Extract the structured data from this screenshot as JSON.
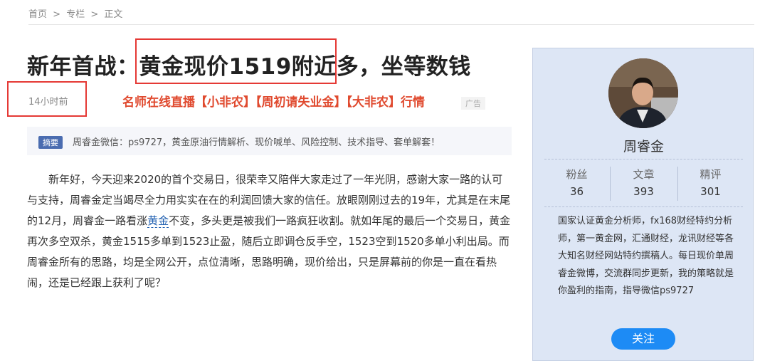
{
  "breadcrumb": {
    "home": "首页",
    "column": "专栏",
    "current": "正文",
    "sep": ">"
  },
  "article": {
    "title": "新年首战：黄金现价1519附近多，坐等数钱",
    "title_parts": [
      "新年首战：",
      "黄金现价1519附近多",
      "，坐等数钱"
    ],
    "time": "14小时前",
    "ad_link": "名师在线直播【小非农】【周初请失业金】【大非农】行情",
    "ad_tag": "广告",
    "summary_tag": "摘要",
    "summary_text": "周睿金微信：ps9727，黄金原油行情解析、现价喊单、风险控制、技术指导、套单解套！",
    "body_before_kw": "新年好，今天迎来2020的首个交易日，很荣幸又陪伴大家走过了一年光阴，感谢大家一路的认可与支持，周睿金定当竭尽全力用实实在在的利润回馈大家的信任。放眼刚刚过去的19年，尤其是在末尾的12月，周睿金一路看涨",
    "body_keyword": "黄金",
    "body_after_kw": "不变，多头更是被我们一路疯狂收割。就如年尾的最后一个交易日，黄金再次多空双杀，黄金1515多单到1523止盈，随后立即调仓反手空，1523空到1520多单小利出局。而周睿金所有的思路，均是全网公开，点位清晰，思路明确，现价给出，只是屏幕前的你是一直在看热闹，还是已经跟上获利了呢？"
  },
  "sidebar": {
    "author": "周睿金",
    "stats": [
      {
        "label": "粉丝",
        "value": "36"
      },
      {
        "label": "文章",
        "value": "393"
      },
      {
        "label": "精评",
        "value": "301"
      }
    ],
    "bio": "国家认证黄金分析师，fx168财经特约分析师，第一黄金网，汇通财经，龙讯财经等各大知名财经网站特约撰稿人。每日现价单周睿金微博，交流群同步更新，我的策略就是你盈利的指南，指导微信ps9727",
    "follow": "关注"
  },
  "colors": {
    "highlight": "#e53935",
    "ad": "#e04a2f",
    "follow": "#1d8bf5",
    "sidebar_bg": "#dde6f5"
  }
}
